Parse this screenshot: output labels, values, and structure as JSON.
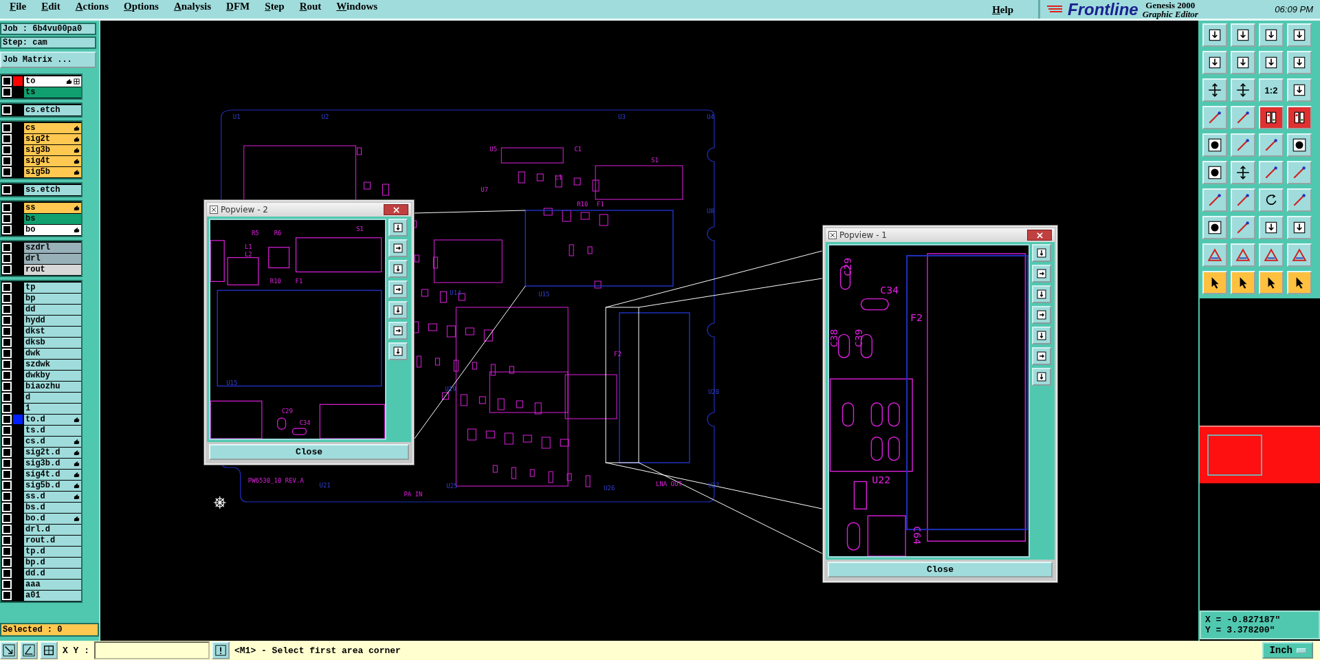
{
  "menu": [
    "File",
    "Edit",
    "Actions",
    "Options",
    "Analysis",
    "DFM",
    "Step",
    "Rout",
    "Windows"
  ],
  "help": "Help",
  "brand": {
    "logo": "Frontline",
    "product": "Genesis 2000",
    "subtitle": "Graphic Editor",
    "time": "06:09 PM"
  },
  "job": {
    "job": "Job : 6b4vu00pa0",
    "step": "Step: cam",
    "matrix_button": "Job Matrix ..."
  },
  "layer_groups": [
    {
      "layers": [
        {
          "name": "to",
          "kind": "silk",
          "checked": false,
          "affected": true,
          "work": true,
          "color": "#ff0000"
        },
        {
          "name": "ts",
          "kind": "mask",
          "checked": false,
          "affected": false,
          "work": false
        }
      ]
    },
    {
      "layers": [
        {
          "name": "cs.etch",
          "kind": "document",
          "checked": false,
          "affected": false,
          "work": false
        }
      ]
    },
    {
      "layers": [
        {
          "name": "cs",
          "kind": "signal",
          "checked": false,
          "affected": true,
          "work": false
        },
        {
          "name": "sig2t",
          "kind": "signal",
          "checked": false,
          "affected": true,
          "work": false
        },
        {
          "name": "sig3b",
          "kind": "signal",
          "checked": false,
          "affected": true,
          "work": false
        },
        {
          "name": "sig4t",
          "kind": "signal",
          "checked": false,
          "affected": true,
          "work": false
        },
        {
          "name": "sig5b",
          "kind": "signal",
          "checked": false,
          "affected": true,
          "work": false
        }
      ]
    },
    {
      "layers": [
        {
          "name": "ss.etch",
          "kind": "document",
          "checked": false,
          "affected": false,
          "work": false
        }
      ]
    },
    {
      "layers": [
        {
          "name": "ss",
          "kind": "signal",
          "checked": false,
          "affected": true,
          "work": false
        },
        {
          "name": "bs",
          "kind": "mask",
          "checked": false,
          "affected": false,
          "work": false
        },
        {
          "name": "bo",
          "kind": "silk",
          "checked": false,
          "affected": true,
          "work": false
        }
      ]
    },
    {
      "layers": [
        {
          "name": "szdrl",
          "kind": "drill",
          "checked": false,
          "affected": false,
          "work": false
        },
        {
          "name": "drl",
          "kind": "drill",
          "checked": false,
          "affected": false,
          "work": false
        },
        {
          "name": "rout",
          "kind": "rout",
          "checked": false,
          "affected": false,
          "work": false
        }
      ]
    },
    {
      "layers": [
        {
          "name": "tp",
          "kind": "document",
          "checked": false,
          "affected": false,
          "work": false
        },
        {
          "name": "bp",
          "kind": "document",
          "checked": false,
          "affected": false,
          "work": false
        },
        {
          "name": "dd",
          "kind": "document",
          "checked": false,
          "affected": false,
          "work": false
        },
        {
          "name": "hydd",
          "kind": "document",
          "checked": false,
          "affected": false,
          "work": false
        },
        {
          "name": "dkst",
          "kind": "document",
          "checked": false,
          "affected": false,
          "work": false
        },
        {
          "name": "dksb",
          "kind": "document",
          "checked": false,
          "affected": false,
          "work": false
        },
        {
          "name": "dwk",
          "kind": "document",
          "checked": false,
          "affected": false,
          "work": false
        },
        {
          "name": "szdwk",
          "kind": "document",
          "checked": false,
          "affected": false,
          "work": false
        },
        {
          "name": "dwkby",
          "kind": "document",
          "checked": false,
          "affected": false,
          "work": false
        },
        {
          "name": "biaozhu",
          "kind": "document",
          "checked": false,
          "affected": false,
          "work": false
        },
        {
          "name": "d",
          "kind": "document",
          "checked": false,
          "affected": false,
          "work": false
        },
        {
          "name": "1",
          "kind": "document",
          "checked": false,
          "affected": false,
          "work": false
        },
        {
          "name": "to.d",
          "kind": "document",
          "checked": false,
          "affected": true,
          "work": false,
          "color": "#0020ff"
        },
        {
          "name": "ts.d",
          "kind": "document",
          "checked": false,
          "affected": false,
          "work": false
        },
        {
          "name": "cs.d",
          "kind": "document",
          "checked": false,
          "affected": true,
          "work": false
        },
        {
          "name": "sig2t.d",
          "kind": "document",
          "checked": false,
          "affected": true,
          "work": false
        },
        {
          "name": "sig3b.d",
          "kind": "document",
          "checked": false,
          "affected": true,
          "work": false
        },
        {
          "name": "sig4t.d",
          "kind": "document",
          "checked": false,
          "affected": true,
          "work": false
        },
        {
          "name": "sig5b.d",
          "kind": "document",
          "checked": false,
          "affected": true,
          "work": false
        },
        {
          "name": "ss.d",
          "kind": "document",
          "checked": false,
          "affected": true,
          "work": false
        },
        {
          "name": "bs.d",
          "kind": "document",
          "checked": false,
          "affected": false,
          "work": false
        },
        {
          "name": "bo.d",
          "kind": "document",
          "checked": false,
          "affected": true,
          "work": false
        },
        {
          "name": "drl.d",
          "kind": "document",
          "checked": false,
          "affected": false,
          "work": false
        },
        {
          "name": "rout.d",
          "kind": "document",
          "checked": false,
          "affected": false,
          "work": false
        },
        {
          "name": "tp.d",
          "kind": "document",
          "checked": false,
          "affected": false,
          "work": false
        },
        {
          "name": "bp.d",
          "kind": "document",
          "checked": false,
          "affected": false,
          "work": false
        },
        {
          "name": "dd.d",
          "kind": "document",
          "checked": false,
          "affected": false,
          "work": false
        },
        {
          "name": "aaa",
          "kind": "document",
          "checked": false,
          "affected": false,
          "work": false
        },
        {
          "name": "a01",
          "kind": "document",
          "checked": false,
          "affected": false,
          "work": false
        }
      ]
    }
  ],
  "selected_count": "Selected : 0",
  "board_labels": [
    "U1",
    "U2",
    "U3",
    "U4",
    "S1",
    "U5",
    "U7",
    "U8",
    "U14",
    "U15",
    "U19",
    "U20",
    "U21",
    "U25",
    "U26",
    "U27",
    "F1",
    "F2",
    "L1",
    "PW6530_10 REV.A",
    "PA IN",
    "LNA OUT",
    "C1",
    "R10"
  ],
  "popviews": [
    {
      "title": "Popview - 2",
      "close_label": "Close",
      "labels": [
        "S1",
        "L1",
        "L2",
        "R10",
        "F1",
        "U15",
        "C29",
        "C34",
        "R5",
        "R6"
      ]
    },
    {
      "title": "Popview - 1",
      "close_label": "Close",
      "labels": [
        "C29",
        "C34",
        "C38",
        "C39",
        "F2",
        "U22",
        "C64"
      ]
    }
  ],
  "toolbox": [
    {
      "kind": "view",
      "tools": [
        {
          "kind": "icon",
          "active": false
        },
        {
          "kind": "icon",
          "active": false
        },
        {
          "kind": "icon",
          "active": false
        },
        {
          "kind": "icon",
          "active": false
        }
      ]
    },
    {
      "kind": "view",
      "tools": [
        {
          "kind": "icon",
          "active": false
        },
        {
          "kind": "icon",
          "active": false
        },
        {
          "kind": "icon",
          "active": false
        },
        {
          "kind": "icon",
          "active": false
        }
      ]
    },
    {
      "kind": "view",
      "tools": [
        {
          "kind": "icon",
          "active": false
        },
        {
          "kind": "icon",
          "active": false
        },
        {
          "kind": "text",
          "label": "1:2",
          "active": false
        },
        {
          "kind": "icon",
          "active": false
        }
      ]
    },
    {
      "kind": "view",
      "tools": [
        {
          "kind": "icon",
          "active": false
        },
        {
          "kind": "icon",
          "active": false
        },
        {
          "kind": "icon",
          "active": true
        },
        {
          "kind": "icon",
          "active": true
        }
      ]
    },
    {
      "kind": "view",
      "tools": [
        {
          "kind": "icon",
          "active": false
        },
        {
          "kind": "icon",
          "active": false
        },
        {
          "kind": "icon",
          "active": false
        },
        {
          "kind": "icon",
          "active": false
        }
      ]
    },
    {
      "kind": "view",
      "tools": [
        {
          "kind": "icon",
          "active": false
        },
        {
          "kind": "icon",
          "active": false
        },
        {
          "kind": "icon",
          "active": false
        },
        {
          "kind": "icon",
          "active": false
        }
      ]
    },
    {
      "kind": "view",
      "tools": [
        {
          "kind": "icon",
          "active": false
        },
        {
          "kind": "icon",
          "active": false
        },
        {
          "kind": "icon",
          "active": false
        },
        {
          "kind": "icon",
          "active": false
        }
      ]
    },
    {
      "kind": "view",
      "tools": [
        {
          "kind": "icon",
          "active": false
        },
        {
          "kind": "icon",
          "active": false
        },
        {
          "kind": "icon",
          "active": false
        },
        {
          "kind": "icon",
          "active": false
        }
      ]
    },
    {
      "kind": "view",
      "tools": [
        {
          "kind": "icon",
          "active": false
        },
        {
          "kind": "icon",
          "active": false
        },
        {
          "kind": "icon",
          "active": false
        },
        {
          "kind": "icon",
          "active": false
        }
      ]
    },
    {
      "kind": "select",
      "tools": [
        {
          "kind": "icon",
          "active": false
        },
        {
          "kind": "icon",
          "active": false
        },
        {
          "kind": "icon",
          "active": false
        },
        {
          "kind": "icon",
          "active": false
        }
      ]
    }
  ],
  "coordinates": {
    "x": "X = -0.827187\"",
    "y": "Y = 3.378200\""
  },
  "bottom": {
    "xy_label": "X Y :",
    "message": "<M1> - Select first area corner",
    "unit": "Inch"
  }
}
